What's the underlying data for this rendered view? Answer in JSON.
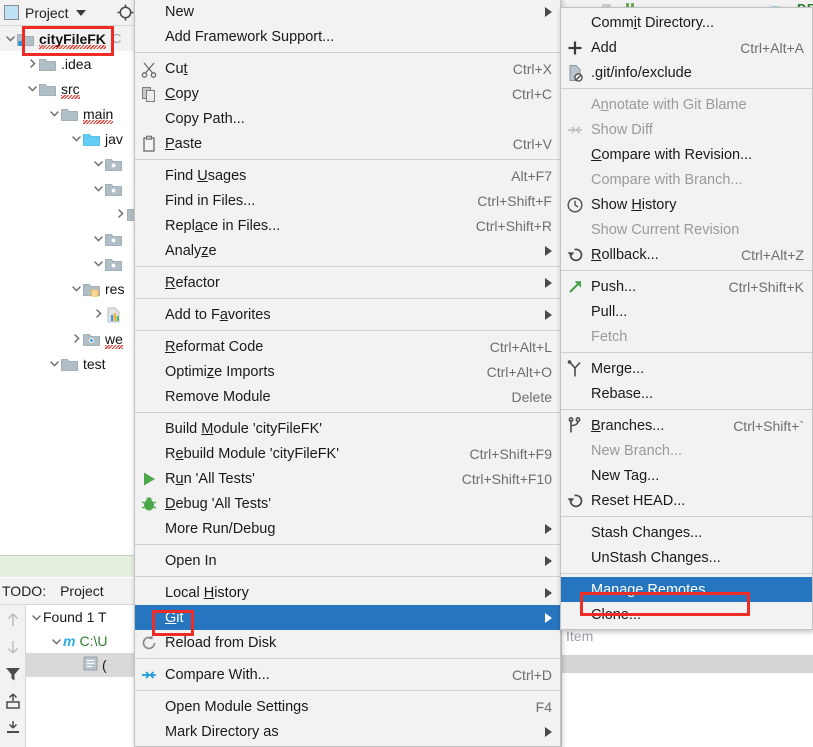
{
  "app": {
    "toolbar_fragment_text": "DBU"
  },
  "project_panel": {
    "title": "Project",
    "icons": {
      "window": "project-window-icon",
      "dropdown": "chevron-down-icon",
      "locate": "locate-target-icon"
    },
    "tree": [
      {
        "label": "cityFileFK",
        "depth": 0,
        "expanded": true,
        "bold": true,
        "icon": "module-folder-icon",
        "error": true,
        "selected": true,
        "trailing": "C"
      },
      {
        "label": ".idea",
        "depth": 1,
        "expanded": false,
        "bold": false,
        "icon": "folder-icon",
        "error": false
      },
      {
        "label": "src",
        "depth": 1,
        "expanded": true,
        "bold": false,
        "icon": "folder-icon",
        "error": true
      },
      {
        "label": "main",
        "depth": 2,
        "expanded": true,
        "bold": false,
        "icon": "folder-icon",
        "error": true
      },
      {
        "label": "jav",
        "depth": 3,
        "expanded": true,
        "bold": false,
        "icon": "source-folder-icon",
        "error": false
      },
      {
        "label": "",
        "depth": 4,
        "expanded": true,
        "bold": false,
        "icon": "package-folder-icon",
        "error": false
      },
      {
        "label": "",
        "depth": 4,
        "expanded": true,
        "bold": false,
        "icon": "package-folder-icon",
        "error": false
      },
      {
        "label": "",
        "depth": 5,
        "expanded": false,
        "bold": false,
        "icon": "package-folder-icon",
        "error": false
      },
      {
        "label": "",
        "depth": 4,
        "expanded": true,
        "bold": false,
        "icon": "package-folder-icon",
        "error": false
      },
      {
        "label": "",
        "depth": 4,
        "expanded": true,
        "bold": false,
        "icon": "package-folder-icon",
        "error": false
      },
      {
        "label": "res",
        "depth": 3,
        "expanded": true,
        "bold": false,
        "icon": "resources-folder-icon",
        "error": false
      },
      {
        "label": "",
        "depth": 4,
        "expanded": false,
        "bold": false,
        "icon": "properties-file-icon",
        "error": false
      },
      {
        "label": "we",
        "depth": 3,
        "expanded": false,
        "bold": false,
        "icon": "web-folder-icon",
        "error": true
      },
      {
        "label": "test",
        "depth": 2,
        "expanded": true,
        "bold": false,
        "icon": "folder-icon",
        "error": false
      }
    ]
  },
  "todo_panel": {
    "tabs": [
      "TODO:",
      "Project"
    ],
    "gutter_icons": [
      "arrow-up-icon",
      "arrow-down-icon",
      "filter-icon",
      "expand-all-icon",
      "collapse-all-icon"
    ],
    "rows": [
      {
        "label": "Found 1 T",
        "depth": 0,
        "expanded": true,
        "icon": "",
        "highlight": false
      },
      {
        "label": "C:\\U",
        "depth": 1,
        "expanded": true,
        "icon": "module-m-icon",
        "highlight": false
      },
      {
        "label": "(",
        "depth": 2,
        "expanded": false,
        "icon": "todo-item-icon",
        "highlight": true
      }
    ]
  },
  "right_panel": {
    "partial_label": "Item"
  },
  "context_menu": {
    "name": "project-context-menu",
    "items": [
      {
        "label": "New",
        "mnemonic": "",
        "shortcut": "",
        "submenu": true,
        "icon": "",
        "disabled": false,
        "selected": false
      },
      {
        "label": "Add Framework Support...",
        "mnemonic": "",
        "shortcut": "",
        "submenu": false,
        "icon": "",
        "disabled": false,
        "selected": false
      },
      {
        "separator": true
      },
      {
        "label": "Cut",
        "mnemonic": "t",
        "shortcut": "Ctrl+X",
        "submenu": false,
        "icon": "cut-icon",
        "disabled": false,
        "selected": false
      },
      {
        "label": "Copy",
        "mnemonic": "C",
        "shortcut": "Ctrl+C",
        "submenu": false,
        "icon": "copy-icon",
        "disabled": false,
        "selected": false
      },
      {
        "label": "Copy Path...",
        "mnemonic": "",
        "shortcut": "",
        "submenu": false,
        "icon": "",
        "disabled": false,
        "selected": false
      },
      {
        "label": "Paste",
        "mnemonic": "P",
        "shortcut": "Ctrl+V",
        "submenu": false,
        "icon": "paste-icon",
        "disabled": false,
        "selected": false
      },
      {
        "separator": true
      },
      {
        "label": "Find Usages",
        "mnemonic": "U",
        "shortcut": "Alt+F7",
        "submenu": false,
        "icon": "",
        "disabled": false,
        "selected": false
      },
      {
        "label": "Find in Files...",
        "mnemonic": "",
        "shortcut": "Ctrl+Shift+F",
        "submenu": false,
        "icon": "",
        "disabled": false,
        "selected": false
      },
      {
        "label": "Replace in Files...",
        "mnemonic": "a",
        "shortcut": "Ctrl+Shift+R",
        "submenu": false,
        "icon": "",
        "disabled": false,
        "selected": false
      },
      {
        "label": "Analyze",
        "mnemonic": "z",
        "shortcut": "",
        "submenu": true,
        "icon": "",
        "disabled": false,
        "selected": false
      },
      {
        "separator": true
      },
      {
        "label": "Refactor",
        "mnemonic": "R",
        "shortcut": "",
        "submenu": true,
        "icon": "",
        "disabled": false,
        "selected": false
      },
      {
        "separator": true
      },
      {
        "label": "Add to Favorites",
        "mnemonic": "a",
        "shortcut": "",
        "submenu": true,
        "icon": "",
        "disabled": false,
        "selected": false
      },
      {
        "separator": true
      },
      {
        "label": "Reformat Code",
        "mnemonic": "R",
        "shortcut": "Ctrl+Alt+L",
        "submenu": false,
        "icon": "",
        "disabled": false,
        "selected": false
      },
      {
        "label": "Optimize Imports",
        "mnemonic": "z",
        "shortcut": "Ctrl+Alt+O",
        "submenu": false,
        "icon": "",
        "disabled": false,
        "selected": false
      },
      {
        "label": "Remove Module",
        "mnemonic": "",
        "shortcut": "Delete",
        "submenu": false,
        "icon": "",
        "disabled": false,
        "selected": false
      },
      {
        "separator": true
      },
      {
        "label": "Build Module 'cityFileFK'",
        "mnemonic": "M",
        "shortcut": "",
        "submenu": false,
        "icon": "",
        "disabled": false,
        "selected": false
      },
      {
        "label": "Rebuild Module 'cityFileFK'",
        "mnemonic": "e",
        "shortcut": "Ctrl+Shift+F9",
        "submenu": false,
        "icon": "",
        "disabled": false,
        "selected": false
      },
      {
        "label": "Run 'All Tests'",
        "mnemonic": "u",
        "shortcut": "Ctrl+Shift+F10",
        "submenu": false,
        "icon": "run-icon",
        "disabled": false,
        "selected": false
      },
      {
        "label": "Debug 'All Tests'",
        "mnemonic": "D",
        "shortcut": "",
        "submenu": false,
        "icon": "debug-icon",
        "disabled": false,
        "selected": false
      },
      {
        "label": "More Run/Debug",
        "mnemonic": "",
        "shortcut": "",
        "submenu": true,
        "icon": "",
        "disabled": false,
        "selected": false
      },
      {
        "separator": true
      },
      {
        "label": "Open In",
        "mnemonic": "",
        "shortcut": "",
        "submenu": true,
        "icon": "",
        "disabled": false,
        "selected": false
      },
      {
        "separator": true
      },
      {
        "label": "Local History",
        "mnemonic": "H",
        "shortcut": "",
        "submenu": true,
        "icon": "",
        "disabled": false,
        "selected": false
      },
      {
        "label": "Git",
        "mnemonic": "G",
        "shortcut": "",
        "submenu": true,
        "icon": "",
        "disabled": false,
        "selected": true
      },
      {
        "label": "Reload from Disk",
        "mnemonic": "",
        "shortcut": "",
        "submenu": false,
        "icon": "reload-icon",
        "disabled": false,
        "selected": false
      },
      {
        "separator": true
      },
      {
        "label": "Compare With...",
        "mnemonic": "",
        "shortcut": "Ctrl+D",
        "submenu": false,
        "icon": "compare-icon",
        "disabled": false,
        "selected": false
      },
      {
        "separator": true
      },
      {
        "label": "Open Module Settings",
        "mnemonic": "",
        "shortcut": "F4",
        "submenu": false,
        "icon": "",
        "disabled": false,
        "selected": false
      },
      {
        "label": "Mark Directory as",
        "mnemonic": "",
        "shortcut": "",
        "submenu": true,
        "icon": "",
        "disabled": false,
        "selected": false
      }
    ]
  },
  "git_submenu": {
    "name": "git-submenu",
    "items": [
      {
        "label": "Commit Directory...",
        "mnemonic": "i",
        "shortcut": "",
        "submenu": false,
        "icon": "",
        "disabled": false,
        "selected": false
      },
      {
        "label": "Add",
        "mnemonic": "",
        "shortcut": "Ctrl+Alt+A",
        "submenu": false,
        "icon": "plus-icon",
        "disabled": false,
        "selected": false
      },
      {
        "label": ".git/info/exclude",
        "mnemonic": "",
        "shortcut": "",
        "submenu": false,
        "icon": "ignore-file-icon",
        "disabled": false,
        "selected": false
      },
      {
        "separator": true
      },
      {
        "label": "Annotate with Git Blame",
        "mnemonic": "n",
        "shortcut": "",
        "submenu": false,
        "icon": "",
        "disabled": true,
        "selected": false
      },
      {
        "label": "Show Diff",
        "mnemonic": "",
        "shortcut": "",
        "submenu": false,
        "icon": "diff-icon",
        "disabled": true,
        "selected": false
      },
      {
        "label": "Compare with Revision...",
        "mnemonic": "C",
        "shortcut": "",
        "submenu": false,
        "icon": "",
        "disabled": false,
        "selected": false
      },
      {
        "label": "Compare with Branch...",
        "mnemonic": "",
        "shortcut": "",
        "submenu": false,
        "icon": "",
        "disabled": true,
        "selected": false
      },
      {
        "label": "Show History",
        "mnemonic": "H",
        "shortcut": "",
        "submenu": false,
        "icon": "history-clock-icon",
        "disabled": false,
        "selected": false
      },
      {
        "label": "Show Current Revision",
        "mnemonic": "",
        "shortcut": "",
        "submenu": false,
        "icon": "",
        "disabled": true,
        "selected": false
      },
      {
        "label": "Rollback...",
        "mnemonic": "R",
        "shortcut": "Ctrl+Alt+Z",
        "submenu": false,
        "icon": "rollback-icon",
        "disabled": false,
        "selected": false
      },
      {
        "separator": true
      },
      {
        "label": "Push...",
        "mnemonic": "",
        "shortcut": "Ctrl+Shift+K",
        "submenu": false,
        "icon": "push-arrow-icon",
        "disabled": false,
        "selected": false
      },
      {
        "label": "Pull...",
        "mnemonic": "",
        "shortcut": "",
        "submenu": false,
        "icon": "",
        "disabled": false,
        "selected": false
      },
      {
        "label": "Fetch",
        "mnemonic": "",
        "shortcut": "",
        "submenu": false,
        "icon": "",
        "disabled": true,
        "selected": false
      },
      {
        "separator": true
      },
      {
        "label": "Merge...",
        "mnemonic": "",
        "shortcut": "",
        "submenu": false,
        "icon": "merge-icon",
        "disabled": false,
        "selected": false
      },
      {
        "label": "Rebase...",
        "mnemonic": "",
        "shortcut": "",
        "submenu": false,
        "icon": "",
        "disabled": false,
        "selected": false
      },
      {
        "separator": true
      },
      {
        "label": "Branches...",
        "mnemonic": "B",
        "shortcut": "Ctrl+Shift+`",
        "submenu": false,
        "icon": "branch-icon",
        "disabled": false,
        "selected": false
      },
      {
        "label": "New Branch...",
        "mnemonic": "",
        "shortcut": "",
        "submenu": false,
        "icon": "",
        "disabled": true,
        "selected": false
      },
      {
        "label": "New Tag...",
        "mnemonic": "",
        "shortcut": "",
        "submenu": false,
        "icon": "",
        "disabled": false,
        "selected": false
      },
      {
        "label": "Reset HEAD...",
        "mnemonic": "",
        "shortcut": "",
        "submenu": false,
        "icon": "reset-head-icon",
        "disabled": false,
        "selected": false
      },
      {
        "separator": true
      },
      {
        "label": "Stash Changes...",
        "mnemonic": "",
        "shortcut": "",
        "submenu": false,
        "icon": "",
        "disabled": false,
        "selected": false
      },
      {
        "label": "UnStash Changes...",
        "mnemonic": "",
        "shortcut": "",
        "submenu": false,
        "icon": "",
        "disabled": false,
        "selected": false
      },
      {
        "separator": true
      },
      {
        "label": "Manage Remotes...",
        "mnemonic": "",
        "shortcut": "",
        "submenu": false,
        "icon": "",
        "disabled": false,
        "selected": true
      },
      {
        "label": "Clone...",
        "mnemonic": "",
        "shortcut": "",
        "submenu": false,
        "icon": "",
        "disabled": false,
        "selected": false
      }
    ]
  },
  "annotations": {
    "color": "#ef2b26",
    "boxes": [
      "cityFileFK",
      "Git",
      "Manage Remotes..."
    ]
  },
  "colors": {
    "selection": "#2675bf",
    "menu_background": "#f2f2f2",
    "annotation_red": "#ef2b26",
    "disabled_text": "#9a9a9a"
  }
}
